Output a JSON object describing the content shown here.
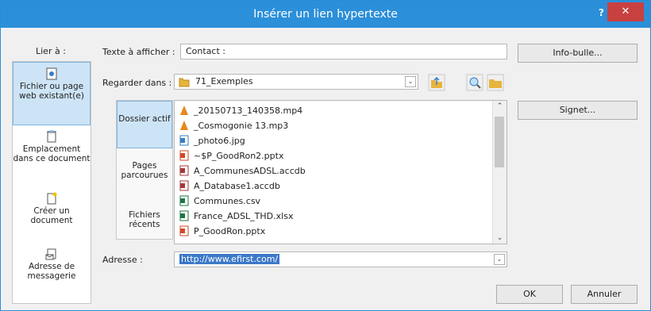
{
  "window": {
    "title": "Insérer un lien hypertexte",
    "help": "?",
    "close": "✕"
  },
  "link_to": {
    "label": "Lier à :",
    "items": [
      {
        "label": "Fichier ou page web existant(e)",
        "icon": "existing-file-icon",
        "active": true
      },
      {
        "label": "Emplacement dans ce document",
        "icon": "place-in-document-icon",
        "active": false
      },
      {
        "label": "Créer un document",
        "icon": "new-document-icon",
        "active": false
      },
      {
        "label": "Adresse de messagerie",
        "icon": "email-address-icon",
        "active": false
      }
    ]
  },
  "display_text": {
    "label": "Texte à afficher :",
    "value": "Contact :"
  },
  "tooltip_button": "Info-bulle...",
  "look_in": {
    "label": "Regarder dans :",
    "value": "71_Exemples"
  },
  "tabs": [
    {
      "label": "Dossier actif",
      "active": true
    },
    {
      "label": "Pages parcourues",
      "active": false
    },
    {
      "label": "Fichiers récents",
      "active": false
    }
  ],
  "files": [
    {
      "name": "_20150713_140358.mp4",
      "icon": "vlc-icon",
      "color": "#e8881a"
    },
    {
      "name": "_Cosmogonie 13.mp3",
      "icon": "vlc-icon",
      "color": "#e8881a"
    },
    {
      "name": "_photo6.jpg",
      "icon": "image-file-icon",
      "color": "#3a7dc0"
    },
    {
      "name": "~$P_GoodRon2.pptx",
      "icon": "powerpoint-file-icon",
      "color": "#d04a2a"
    },
    {
      "name": "A_CommunesADSL.accdb",
      "icon": "access-file-icon",
      "color": "#a4373a"
    },
    {
      "name": "A_Database1.accdb",
      "icon": "access-file-icon",
      "color": "#a4373a"
    },
    {
      "name": "Communes.csv",
      "icon": "excel-file-icon",
      "color": "#217346"
    },
    {
      "name": "France_ADSL_THD.xlsx",
      "icon": "excel-file-icon",
      "color": "#217346"
    },
    {
      "name": "P_GoodRon.pptx",
      "icon": "powerpoint-file-icon",
      "color": "#d04a2a"
    }
  ],
  "bookmark_button": "Signet...",
  "address": {
    "label": "Adresse :",
    "value": "http://www.efirst.com/"
  },
  "ok_button": "OK",
  "cancel_button": "Annuler",
  "colors": {
    "titlebar": "#2b8fd9",
    "selection": "#cde4f6",
    "close": "#c94040"
  }
}
